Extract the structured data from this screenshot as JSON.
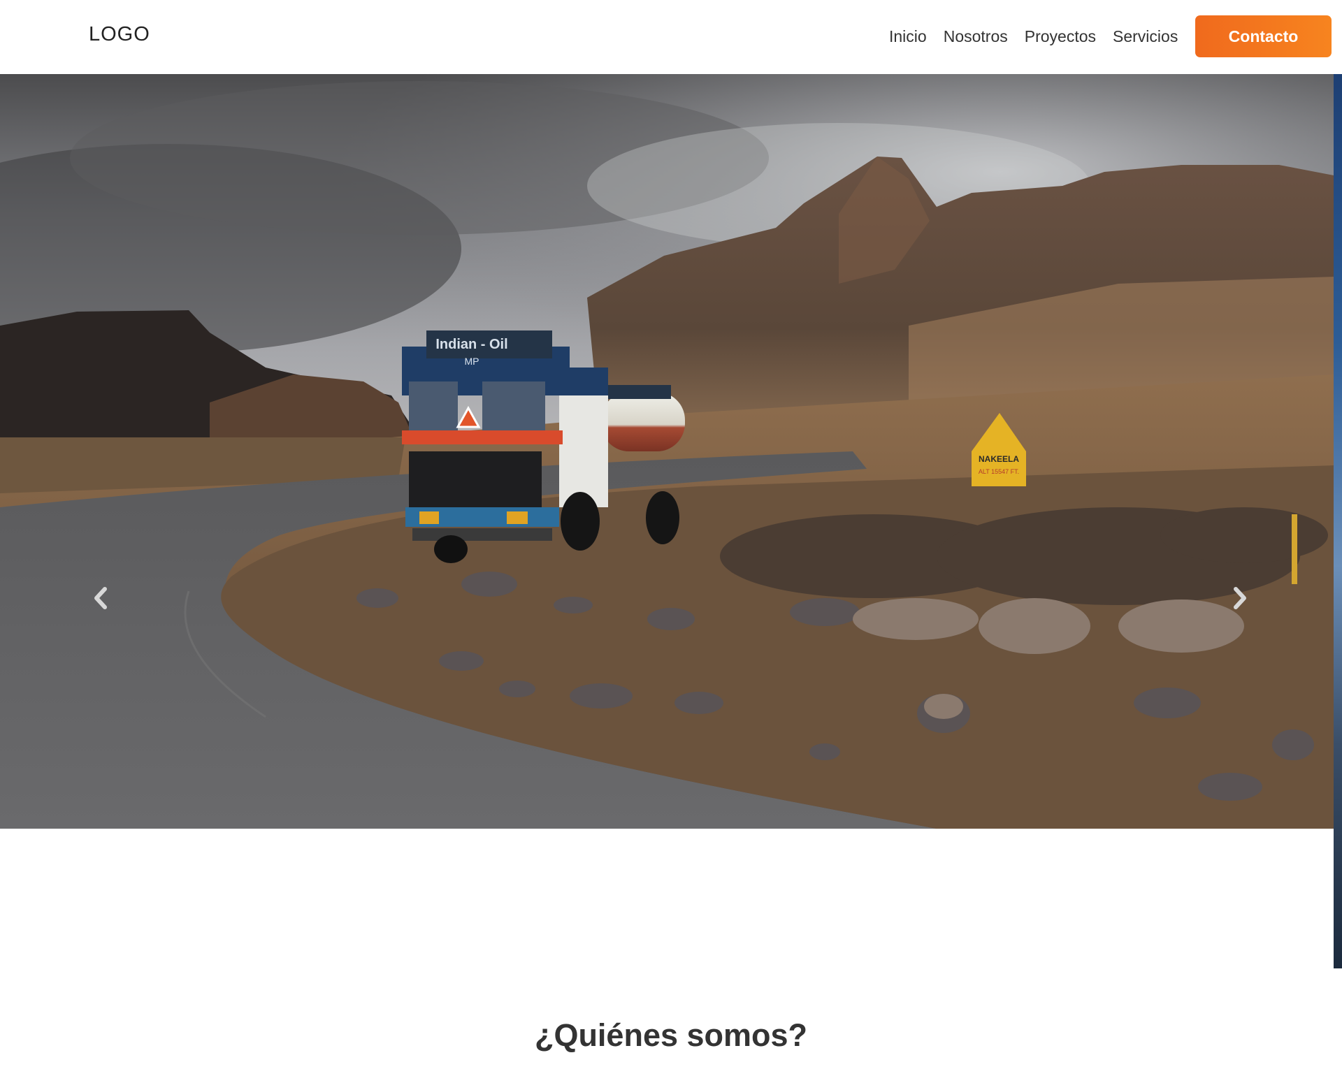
{
  "navbar": {
    "logo": "LOGO",
    "links": [
      "Inicio",
      "Nosotros",
      "Proyectos",
      "Servicios"
    ],
    "contact_label": "Contacto",
    "contact_color": "#f47920"
  },
  "hero": {
    "slide_description_icons": {
      "prev": "chevron-left-icon",
      "next": "chevron-right-icon"
    },
    "truck_text": "Indian - Oil",
    "truck_plate": "MP",
    "sign_name": "NAKEELA",
    "sign_alt": "ALT 15547 FT."
  },
  "about": {
    "title": "¿Quiénes somos?"
  }
}
